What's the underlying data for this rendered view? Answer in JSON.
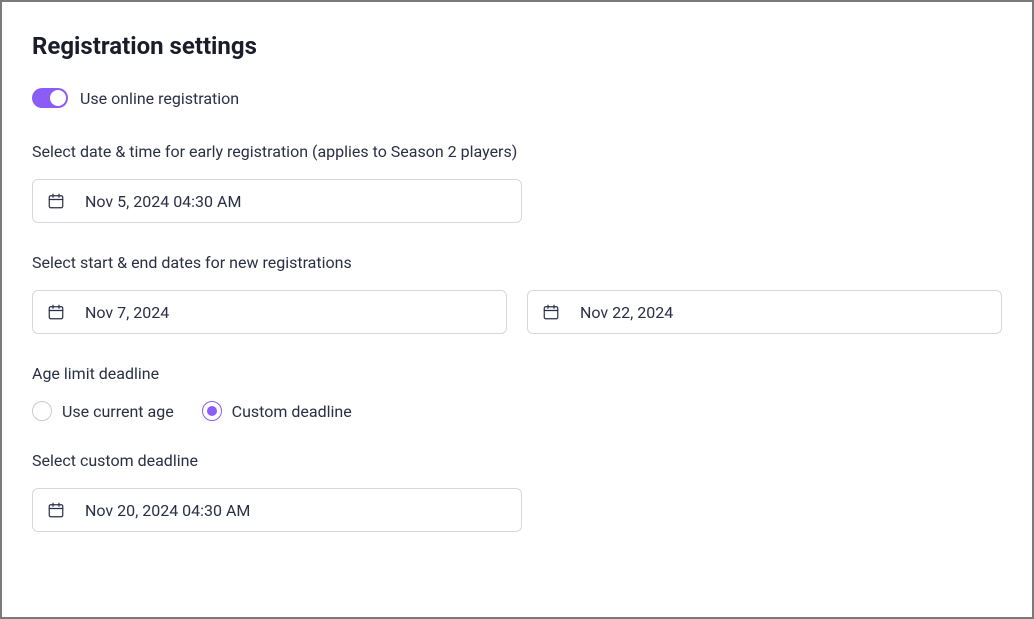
{
  "title": "Registration settings",
  "onlineRegistration": {
    "label": "Use online registration",
    "enabled": true
  },
  "earlyRegistration": {
    "label": "Select date & time for early registration (applies to Season 2 players)",
    "value": "Nov 5, 2024 04:30 AM"
  },
  "newRegistrations": {
    "label": "Select start & end dates for new registrations",
    "start": "Nov 7, 2024",
    "end": "Nov 22, 2024"
  },
  "ageLimit": {
    "label": "Age limit deadline",
    "options": {
      "current": "Use current age",
      "custom": "Custom deadline"
    },
    "selected": "custom"
  },
  "customDeadline": {
    "label": "Select custom deadline",
    "value": "Nov 20, 2024 04:30 AM"
  }
}
